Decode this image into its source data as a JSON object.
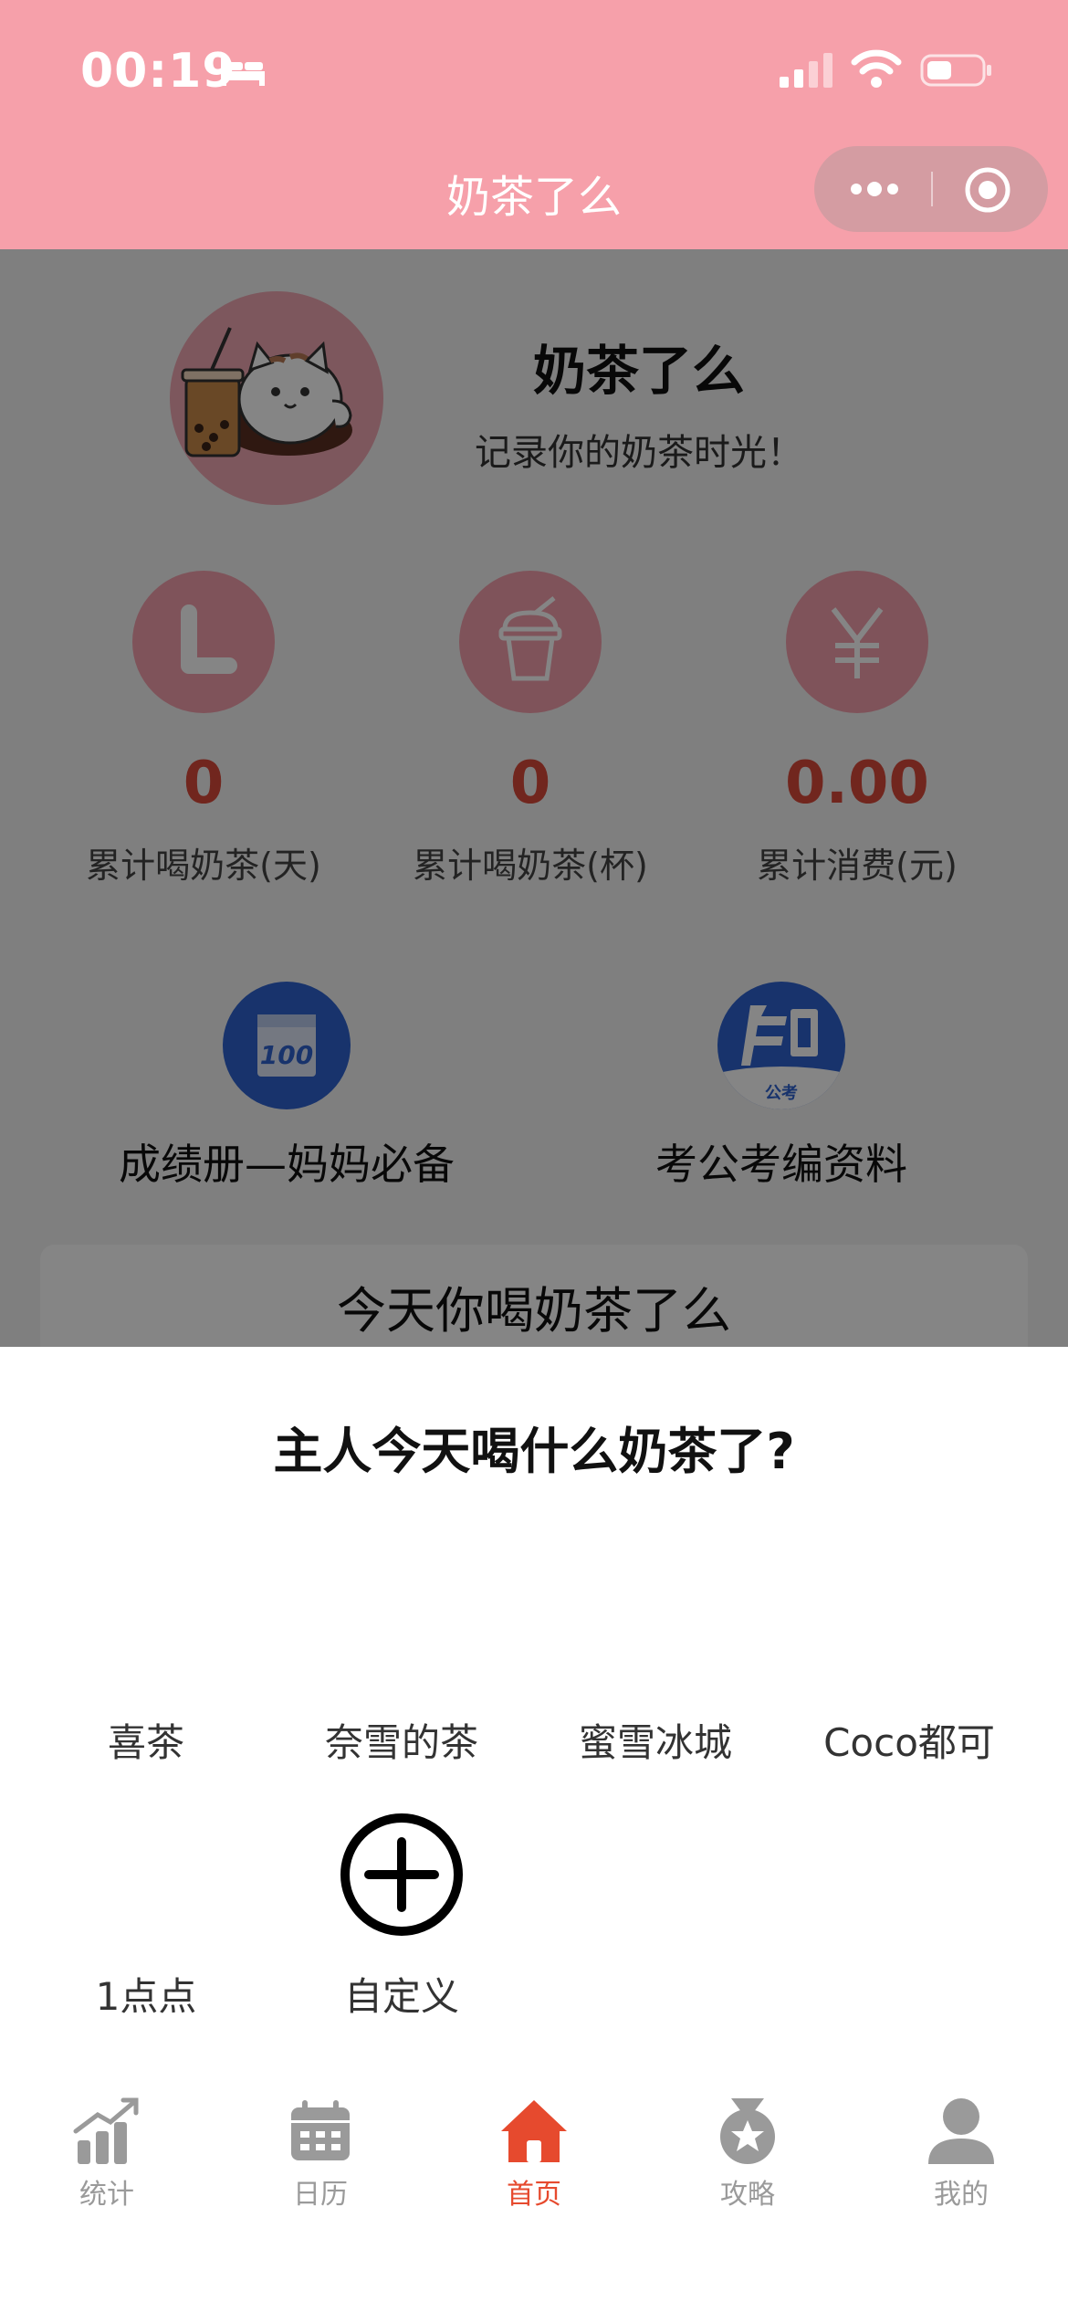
{
  "status_bar": {
    "time": "00:19"
  },
  "nav": {
    "title": "奶茶了么"
  },
  "header": {
    "app_name": "奶茶了么",
    "slogan": "记录你的奶茶时光！"
  },
  "stats": [
    {
      "value": "0",
      "label": "累计喝奶茶(天)",
      "icon": "clock-icon"
    },
    {
      "value": "0",
      "label": "累计喝奶茶(杯)",
      "icon": "cup-icon"
    },
    {
      "value": "0.00",
      "label": "累计消费(元)",
      "icon": "yen-icon"
    }
  ],
  "links": [
    {
      "label": "成绩册—妈妈必备",
      "icon": "score-100-icon"
    },
    {
      "label": "考公考编资料",
      "icon": "zhi-gongkao-icon",
      "badge_text": "公考"
    }
  ],
  "today_card": {
    "text": "今天你喝奶茶了么"
  },
  "sheet": {
    "title": "主人今天喝什么奶茶了?",
    "brands": [
      "喜茶",
      "奈雪的茶",
      "蜜雪冰城",
      "Coco都可",
      "1点点"
    ],
    "custom_label": "自定义"
  },
  "tabbar": {
    "items": [
      {
        "label": "统计",
        "icon": "chart-icon"
      },
      {
        "label": "日历",
        "icon": "calendar-icon"
      },
      {
        "label": "首页",
        "icon": "home-icon",
        "active": true
      },
      {
        "label": "攻略",
        "icon": "medal-icon"
      },
      {
        "label": "我的",
        "icon": "user-icon"
      }
    ]
  },
  "colors": {
    "nav_bg": "#f6a0aa",
    "accent_red": "#d84a3a",
    "tab_active": "#e64a2e",
    "badge_blue": "#2e63cf"
  }
}
